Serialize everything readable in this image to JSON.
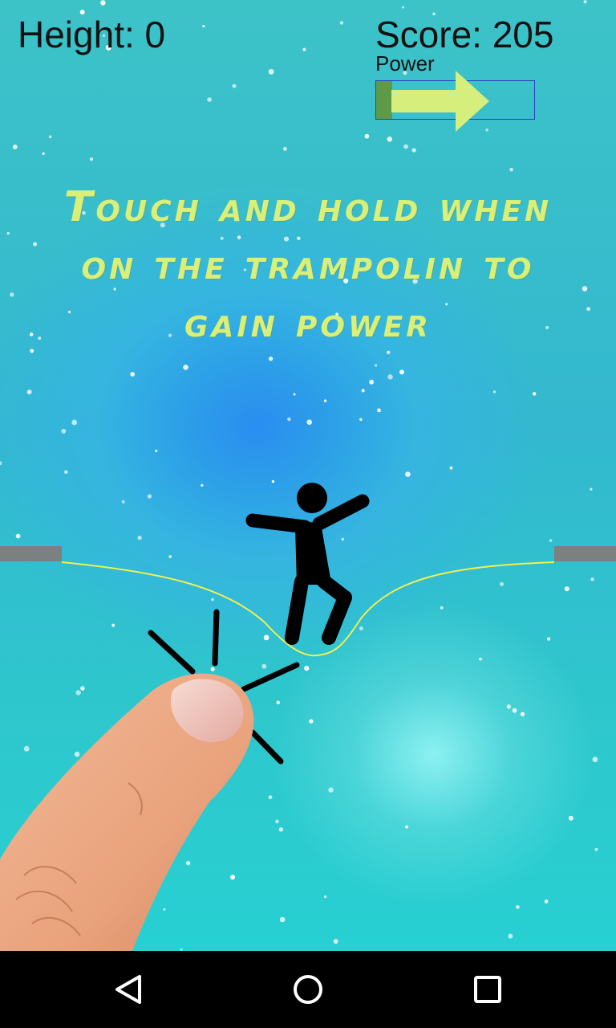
{
  "hud": {
    "height_text": "Height: 0",
    "score_text": "Score: 205",
    "power_label": "Power",
    "power_level": 0.1
  },
  "hint": {
    "lines": [
      "Touch and hold when",
      "on the trampolin to",
      "gain power"
    ]
  },
  "colors": {
    "hint_text": "#d9ef78",
    "arrow": "#d5ee7c",
    "power_fill": "#5f9a48",
    "power_border": "#2a3cc0",
    "trampoline": "#f0f050",
    "post": "#7b8181"
  },
  "icons": {
    "nav_back": "back-triangle-icon",
    "nav_home": "home-circle-icon",
    "nav_recents": "recents-square-icon"
  }
}
